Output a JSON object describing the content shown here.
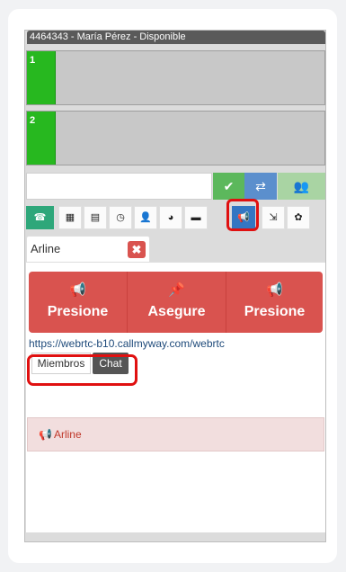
{
  "titlebar": {
    "text": "4464343 - María Pérez - Disponible"
  },
  "lines": [
    {
      "number": "1"
    },
    {
      "number": "2"
    }
  ],
  "dial": {
    "value": "",
    "placeholder": "",
    "call_icon": "✔",
    "transfer_icon": "⇄",
    "conference_icon": "👥"
  },
  "toolbar": {
    "icons": [
      {
        "name": "phone-icon",
        "glyph": "☎"
      },
      {
        "name": "keypad-icon",
        "glyph": "▦"
      },
      {
        "name": "list-icon",
        "glyph": "▤"
      },
      {
        "name": "clock-icon",
        "glyph": "◷"
      },
      {
        "name": "user-icon",
        "glyph": "👤"
      },
      {
        "name": "globe-icon",
        "glyph": "◕"
      },
      {
        "name": "chat-icon",
        "glyph": "▬"
      },
      {
        "name": "megaphone-icon",
        "glyph": "📢"
      },
      {
        "name": "logout-icon",
        "glyph": "⇲"
      },
      {
        "name": "gear-icon",
        "glyph": "✿"
      }
    ],
    "active": "megaphone-icon"
  },
  "session_tag": {
    "name": "Arline",
    "close_icon": "✖"
  },
  "actions": [
    {
      "icon": "📢",
      "label": "Presione"
    },
    {
      "icon": "📌",
      "label": "Asegure"
    },
    {
      "icon": "📢",
      "label": "Presione"
    }
  ],
  "url": "https://webrtc-b10.callmyway.com/webrtc",
  "tabs": {
    "members": "Miembros",
    "chat": "Chat",
    "active": "Chat"
  },
  "members": [
    {
      "icon": "📢",
      "name": "Arline"
    }
  ],
  "colors": {
    "line_active": "#27b81f",
    "danger": "#d9534f",
    "primary": "#3476c2",
    "success": "#5cb85c",
    "highlight": "#e01010"
  }
}
